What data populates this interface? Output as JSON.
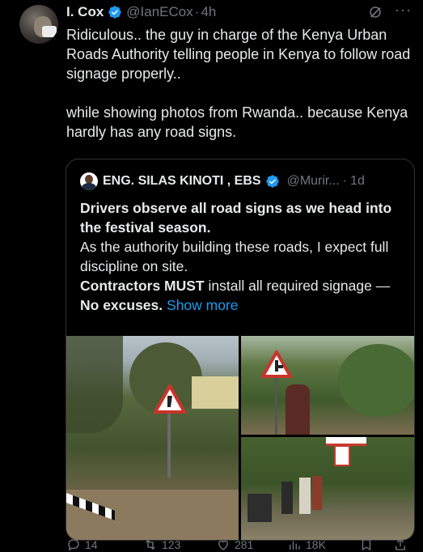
{
  "tweet": {
    "author_name": "I. Cox",
    "handle": "@IanECox",
    "separator": "·",
    "time": "4h",
    "paragraphs": [
      "Ridiculous.. the guy in charge of the Kenya Urban Roads Authority telling people in Kenya to follow road signage properly..",
      "while showing photos from Rwanda.. because Kenya hardly has any road signs."
    ],
    "more_label": "···"
  },
  "quote": {
    "author_name": "ENG. SILAS KINOTI , EBS",
    "handle": "@Murir...",
    "time_sep": "·",
    "time": "1d",
    "line1": "Drivers observe all road signs as we head into the festival season.",
    "line2": "As the authority building these roads, I expect full discipline on site.",
    "line3_bold": "Contractors MUST",
    "line3_rest": " install all required signage — ",
    "line3_bold2": "No excuses.",
    "show_more": "Show more"
  },
  "actions": {
    "replies": "14",
    "reposts": "123",
    "likes": "281",
    "views": "18K"
  },
  "colors": {
    "background": "#000000",
    "text": "#e7e9ea",
    "muted": "#71767b",
    "link": "#1d9bf0",
    "verified": "#1d9bf0"
  },
  "icons": [
    "verified-badge-icon",
    "grok-icon",
    "more-icon",
    "reply-icon",
    "repost-icon",
    "like-icon",
    "views-icon",
    "bookmark-icon",
    "share-icon"
  ]
}
